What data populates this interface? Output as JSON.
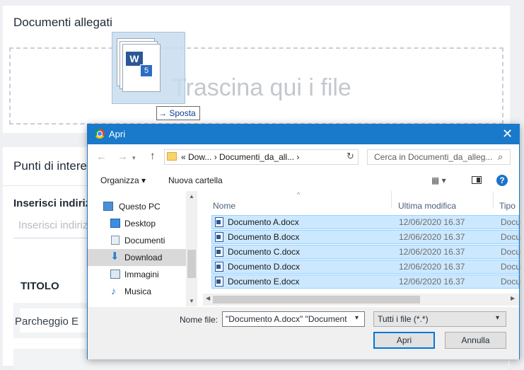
{
  "page": {
    "section1_title": "Documenti allegati",
    "dropzone_text": "Trascina qui i file",
    "section2_title": "Punti di intere",
    "address_label": "Inserisci indiriz",
    "address_placeholder": "Inserisci indiriz",
    "column_title": "TITOLO",
    "row1_text": "Parcheggio E"
  },
  "drag": {
    "file_count": "5",
    "app_glyph": "W",
    "tooltip_icon": "→",
    "tooltip_label": "Sposta"
  },
  "dialog": {
    "title": "Apri",
    "close_glyph": "✕",
    "nav": {
      "back_glyph": "←",
      "forward_glyph": "→",
      "up_glyph": "↑",
      "address_text": "«  Dow...  ›  Documenti_da_all...  ›",
      "refresh_glyph": "↻",
      "search_placeholder": "Cerca in Documenti_da_alleg...",
      "search_glyph": "⌕"
    },
    "toolbar": {
      "organize_label": "Organizza ▾",
      "new_folder_label": "Nuova cartella",
      "view_glyph": "▦ ▾",
      "help_glyph": "?"
    },
    "sidebar": [
      {
        "label": "Questo PC",
        "icon": "computer-icon",
        "color": "#4a90d9",
        "selected": false
      },
      {
        "label": "Desktop",
        "icon": "desktop-icon",
        "color": "#3a8ee6",
        "selected": false
      },
      {
        "label": "Documenti",
        "icon": "documents-icon",
        "color": "#9fb4cc",
        "selected": false
      },
      {
        "label": "Download",
        "icon": "download-icon",
        "color": "#2d7fd3",
        "selected": true
      },
      {
        "label": "Immagini",
        "icon": "pictures-icon",
        "color": "#7aa6cf",
        "selected": false
      },
      {
        "label": "Musica",
        "icon": "music-icon",
        "color": "#2b6cc4",
        "selected": false
      }
    ],
    "columns": {
      "name": "Nome",
      "modified": "Ultima modifica",
      "type": "Tipo"
    },
    "files": [
      {
        "name": "Documento A.docx",
        "modified": "12/06/2020 16.37",
        "type": "Docu"
      },
      {
        "name": "Documento B.docx",
        "modified": "12/06/2020 16.37",
        "type": "Docu"
      },
      {
        "name": "Documento C.docx",
        "modified": "12/06/2020 16.37",
        "type": "Docu"
      },
      {
        "name": "Documento D.docx",
        "modified": "12/06/2020 16.37",
        "type": "Docu"
      },
      {
        "name": "Documento E.docx",
        "modified": "12/06/2020 16.37",
        "type": "Docu"
      }
    ],
    "footer": {
      "filename_label": "Nome file:",
      "filename_value": "\"Documento A.docx\" \"Document",
      "filetype_value": "Tutti i file (*.*)",
      "open_label": "Apri",
      "cancel_label": "Annulla"
    }
  },
  "colors": {
    "accent": "#1979ca",
    "selection": "#cce8ff",
    "selection_border": "#99d1ff"
  }
}
